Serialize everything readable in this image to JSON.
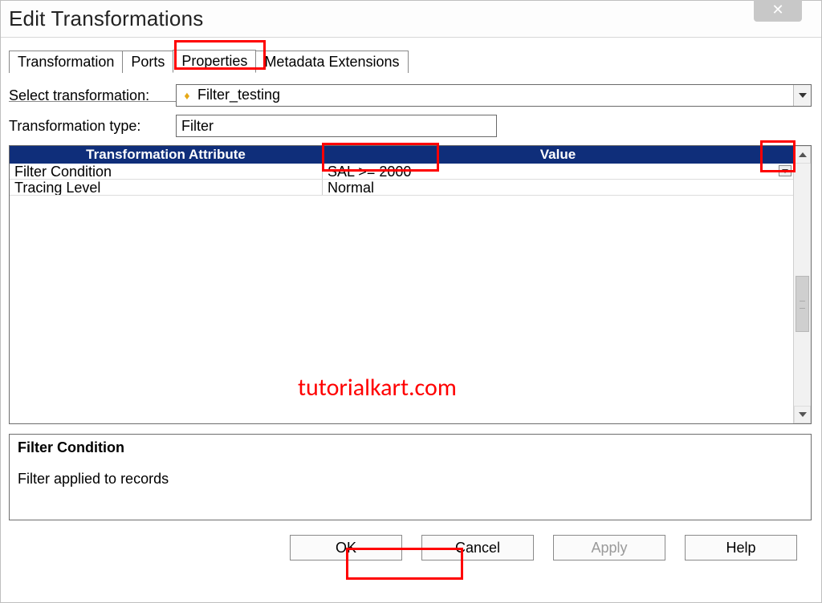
{
  "window": {
    "title": "Edit Transformations"
  },
  "tabs": {
    "transformation": "Transformation",
    "ports": "Ports",
    "properties": "Properties",
    "metadata_extensions": "Metadata Extensions"
  },
  "labels": {
    "select_transformation": "Select transformation:",
    "transformation_type": "Transformation type:"
  },
  "fields": {
    "select_transformation_value": "Filter_testing",
    "transformation_type_value": "Filter"
  },
  "grid": {
    "header_attribute": "Transformation Attribute",
    "header_value": "Value",
    "rows": [
      {
        "attr": "Filter Condition",
        "val": "SAL >= 2000",
        "has_editor": true
      },
      {
        "attr": "Tracing Level",
        "val": "Normal",
        "has_editor": false
      }
    ]
  },
  "description": {
    "title": "Filter Condition",
    "text": "Filter applied to records"
  },
  "buttons": {
    "ok": "OK",
    "cancel": "Cancel",
    "apply": "Apply",
    "help": "Help"
  },
  "watermark": "tutorialkart.com"
}
